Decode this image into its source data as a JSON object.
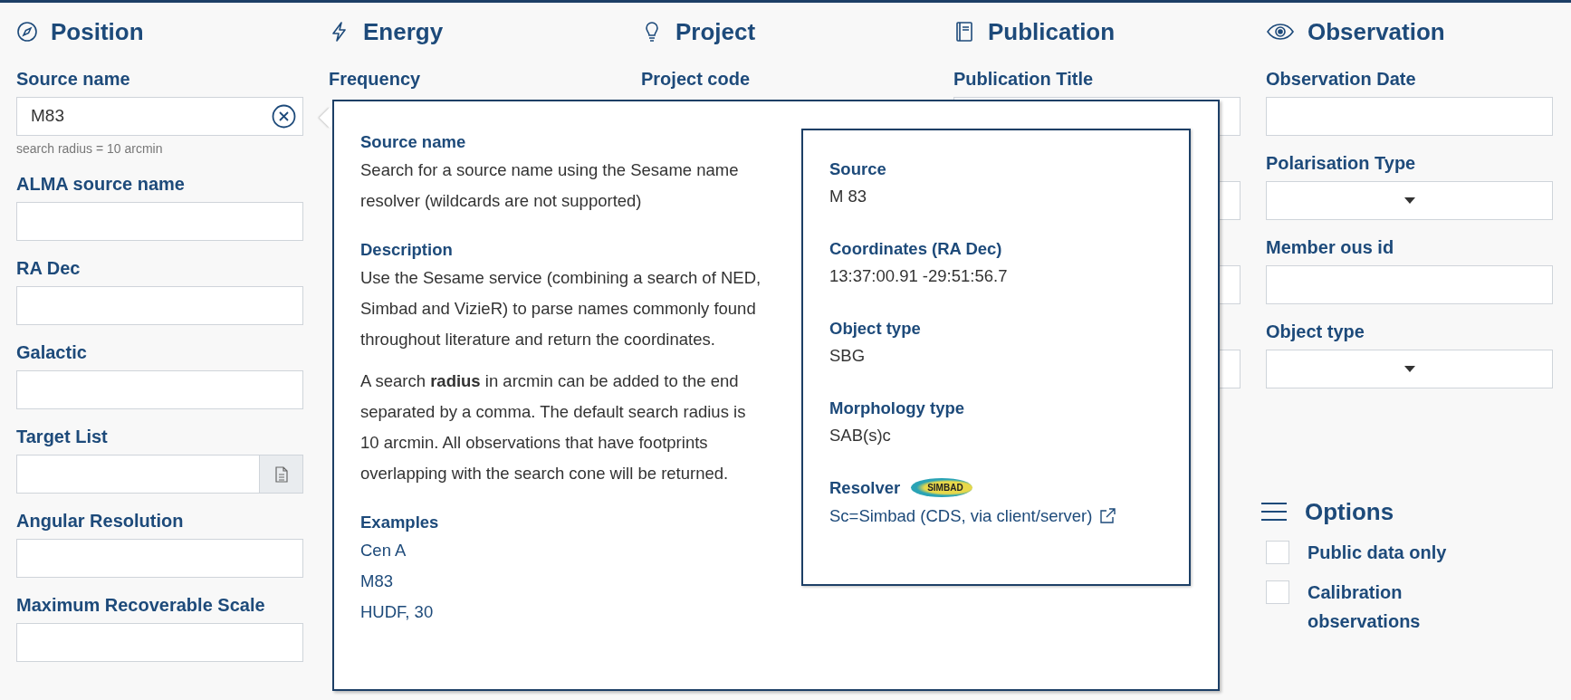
{
  "sections": [
    {
      "title": "Position",
      "fields": [
        {
          "label": "Source name",
          "kind": "search",
          "value": "M83",
          "helper": "search radius = 10 arcmin"
        },
        {
          "label": "ALMA source name",
          "kind": "text"
        },
        {
          "label": "RA Dec",
          "kind": "text"
        },
        {
          "label": "Galactic",
          "kind": "text"
        },
        {
          "label": "Target List",
          "kind": "file"
        },
        {
          "label": "Angular Resolution",
          "kind": "text"
        },
        {
          "label": "Maximum Recoverable Scale",
          "kind": "text"
        }
      ]
    },
    {
      "title": "Energy",
      "fields": [
        {
          "label": "Frequency",
          "kind": "none"
        }
      ]
    },
    {
      "title": "Project",
      "fields": [
        {
          "label": "Project code",
          "kind": "none"
        }
      ]
    },
    {
      "title": "Publication",
      "fields": [
        {
          "label": "Publication Title",
          "kind": "text"
        },
        {
          "kind": "text"
        },
        {
          "kind": "text"
        },
        {
          "kind": "text"
        }
      ]
    },
    {
      "title": "Observation",
      "fields": [
        {
          "label": "Observation Date",
          "kind": "text"
        },
        {
          "label": "Polarisation Type",
          "kind": "select"
        },
        {
          "label": "Member ous id",
          "kind": "text"
        },
        {
          "label": "Object type",
          "kind": "select"
        }
      ]
    }
  ],
  "options": {
    "title": "Options",
    "items": [
      {
        "label": "Public data only",
        "checked": false
      },
      {
        "label": "Calibration observations",
        "checked": false
      }
    ]
  },
  "help_popup": {
    "blocks": [
      {
        "heading": "Source name",
        "paragraphs": [
          "Search for a source name using the Sesame name resolver (wildcards are not supported)"
        ]
      },
      {
        "heading": "Description",
        "paragraphs": [
          "Use the Sesame service (combining a search of NED, Simbad and VizieR) to parse names commonly found throughout literature and return the coordinates.",
          "A search **radius** in arcmin can be added to the end separated by a comma. The default search radius is 10 arcmin. All observations that have footprints overlapping with the search cone will be returned."
        ]
      },
      {
        "heading": "Examples",
        "examples": [
          "Cen A",
          "M83",
          "HUDF, 30"
        ]
      }
    ],
    "result": {
      "items": [
        {
          "heading": "Source",
          "value": "M 83"
        },
        {
          "heading": "Coordinates (RA Dec)",
          "value": "13:37:00.91 -29:51:56.7"
        },
        {
          "heading": "Object type",
          "value": "SBG"
        },
        {
          "heading": "Morphology type",
          "value": "SAB(s)c"
        }
      ],
      "resolver": {
        "label": "Resolver",
        "logo_text": "SIMBAD",
        "link": "Sc=Simbad (CDS, via client/server)"
      }
    }
  }
}
